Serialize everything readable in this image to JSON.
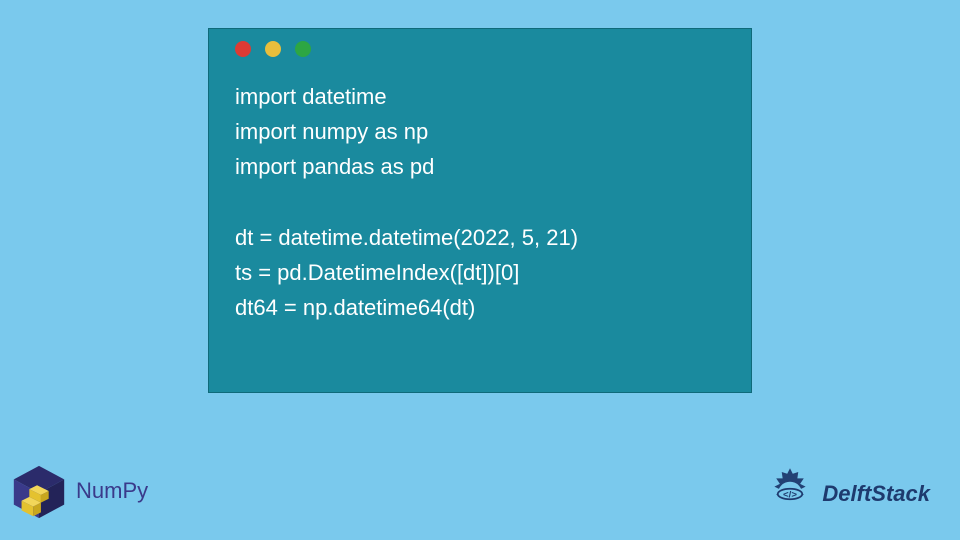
{
  "code": {
    "lines": [
      "import datetime",
      "import numpy as np",
      "import pandas as pd",
      "",
      "dt = datetime.datetime(2022, 5, 21)",
      "ts = pd.DatetimeIndex([dt])[0]",
      "dt64 = np.datetime64(dt)"
    ]
  },
  "logos": {
    "numpy_label": "NumPy",
    "delft_label": "DelftStack"
  },
  "colors": {
    "background": "#7ac9ed",
    "code_bg": "#1a8a9e",
    "code_text": "#ffffff",
    "dot_red": "#dd3b34",
    "dot_yellow": "#e8be3c",
    "dot_green": "#2da643",
    "numpy_text": "#3a3a8a",
    "delft_text": "#1e3a6e"
  }
}
